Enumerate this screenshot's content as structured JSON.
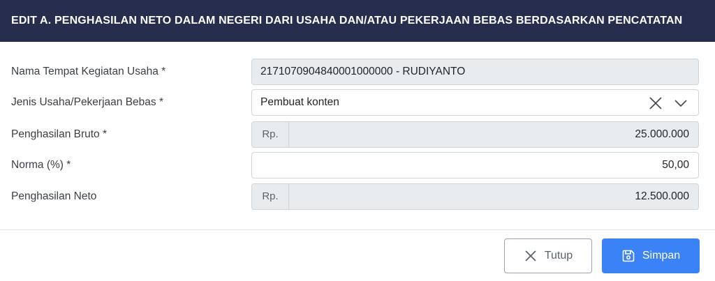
{
  "modal": {
    "title": "EDIT A. PENGHASILAN NETO DALAM NEGERI DARI USAHA DAN/ATAU PEKERJAAN BEBAS BERDASARKAN PENCATATAN"
  },
  "form": {
    "nama_tempat": {
      "label": "Nama Tempat Kegiatan Usaha *",
      "value": "2171070904840001000000 - RUDIYANTO"
    },
    "jenis_usaha": {
      "label": "Jenis Usaha/Pekerjaan Bebas *",
      "value": "Pembuat konten"
    },
    "bruto": {
      "label": "Penghasilan Bruto *",
      "prefix": "Rp.",
      "value": "25.000.000"
    },
    "norma": {
      "label": "Norma (%) *",
      "value": "50,00"
    },
    "neto": {
      "label": "Penghasilan Neto",
      "prefix": "Rp.",
      "value": "12.500.000"
    }
  },
  "footer": {
    "close_label": "Tutup",
    "save_label": "Simpan"
  },
  "icons": {
    "clear": "close-icon",
    "dropdown": "chevron-down-icon",
    "close_button": "close-icon",
    "save_button": "floppy-disk-icon"
  },
  "colors": {
    "header_bg": "#262d4d",
    "primary": "#3b82f6",
    "readonly_bg": "#e9ecef"
  }
}
